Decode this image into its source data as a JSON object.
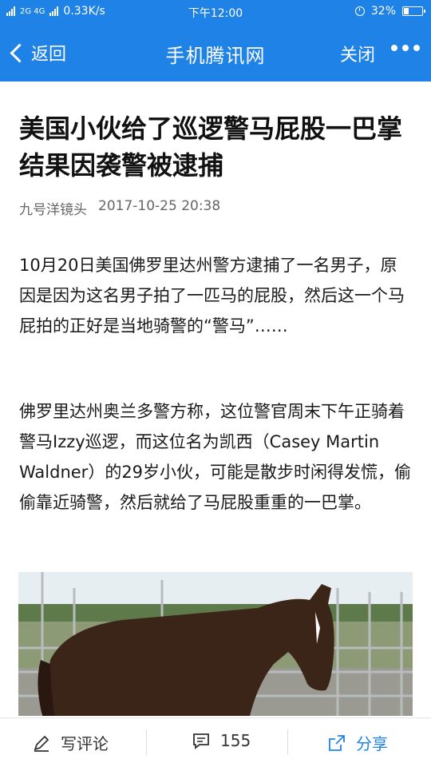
{
  "status_bar": {
    "network": "2G 4G",
    "speed": "0.33K/s",
    "time": "下午12:00",
    "battery": "32%",
    "battery_level": 0.32,
    "icons": [
      "signal-icon",
      "alarm-icon",
      "battery-icon"
    ]
  },
  "nav": {
    "back_label": "返回",
    "title": "手机腾讯网",
    "close_label": "关闭",
    "more_icon": "more-dots-icon"
  },
  "article": {
    "title": "美国小伙给了巡逻警马屁股一巴掌 结果因袭警被逮捕",
    "source": "九号洋镜头",
    "time": "2017-10-25 20:38",
    "paragraphs": [
      "10月20日美国佛罗里达州警方逮捕了一名男子，原因是因为这名男子拍了一匹马的屁股，然后这一个马屁拍的正好是当地骑警的“警马”……",
      "佛罗里达州奥兰多警方称，这位警官周末下午正骑着警马Izzy巡逻，而这位名为凯西（Casey Martin Waldner）的29岁小伙，可能是散步时闲得发慌，偷偷靠近骑警，然后就给了马屁股重重的一巴掌。"
    ]
  },
  "bottom_bar": {
    "comment_label": "写评论",
    "comment_count": "155",
    "share_label": "分享"
  },
  "colors": {
    "accent": "#1e82e6"
  }
}
